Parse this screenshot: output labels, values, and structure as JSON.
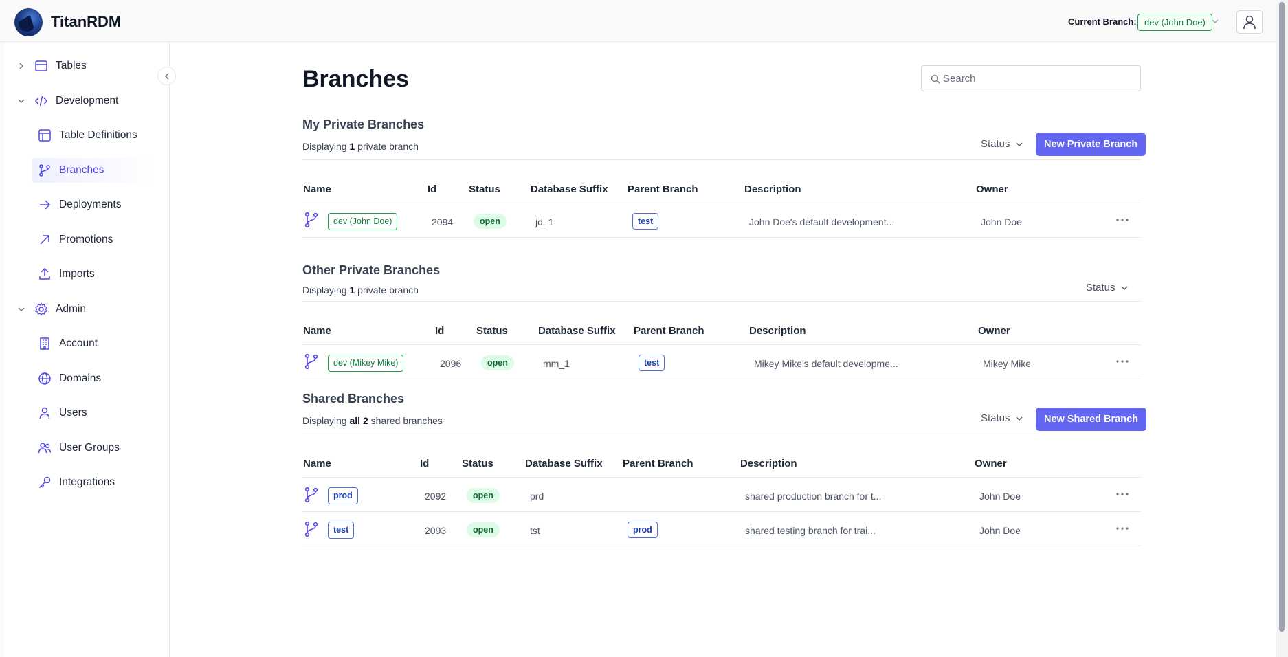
{
  "app": {
    "title": "TitanRDM"
  },
  "header": {
    "current_branch_label": "Current Branch:",
    "current_branch": "dev (John Doe)"
  },
  "sidebar": {
    "tables": "Tables",
    "development": "Development",
    "table_definitions": "Table Definitions",
    "branches": "Branches",
    "deployments": "Deployments",
    "promotions": "Promotions",
    "imports": "Imports",
    "admin": "Admin",
    "account": "Account",
    "domains": "Domains",
    "users": "Users",
    "user_groups": "User Groups",
    "integrations": "Integrations"
  },
  "page": {
    "title": "Branches",
    "search_placeholder": "Search"
  },
  "columns": {
    "name": "Name",
    "id": "Id",
    "status": "Status",
    "db_suffix": "Database Suffix",
    "parent": "Parent Branch",
    "description": "Description",
    "owner": "Owner"
  },
  "my_private": {
    "title": "My Private Branches",
    "count_prefix": "Displaying",
    "count_num": "1",
    "count_suffix": "private branch",
    "status_filter": "Status",
    "button": "New Private Branch",
    "rows": [
      {
        "name": "dev (John Doe)",
        "id": "2094",
        "status": "open",
        "suffix": "jd_1",
        "parent": "test",
        "description": "John Doe's default development...",
        "owner": "John Doe"
      }
    ]
  },
  "other_private": {
    "title": "Other Private Branches",
    "count_prefix": "Displaying",
    "count_num": "1",
    "count_suffix": "private branch",
    "status_filter": "Status",
    "rows": [
      {
        "name": "dev (Mikey Mike)",
        "id": "2096",
        "status": "open",
        "suffix": "mm_1",
        "parent": "test",
        "description": "Mikey Mike's default developme...",
        "owner": "Mikey Mike"
      }
    ]
  },
  "shared": {
    "title": "Shared Branches",
    "count_prefix": "Displaying",
    "count_num": "all 2",
    "count_suffix": "shared branches",
    "status_filter": "Status",
    "button": "New Shared Branch",
    "rows": [
      {
        "name": "prod",
        "id": "2092",
        "status": "open",
        "suffix": "prd",
        "parent": "",
        "description": "shared production branch for t...",
        "owner": "John Doe"
      },
      {
        "name": "test",
        "id": "2093",
        "status": "open",
        "suffix": "tst",
        "parent": "prod",
        "description": "shared testing branch for trai...",
        "owner": "John Doe"
      }
    ]
  },
  "icons": {
    "logo": "titanrdm-logo",
    "chevron": "chevron-down-icon",
    "user": "user-icon",
    "branch": "git-branch-icon",
    "more": "more-horizontal-icon",
    "search": "search-icon"
  },
  "colors": {
    "accent": "#6366f1",
    "active_nav": "#4f46e5",
    "open_pill_bg": "#dcfce7",
    "open_pill_text": "#166534",
    "green_badge": "#16a34a",
    "blue_badge": "#4f70d8"
  }
}
